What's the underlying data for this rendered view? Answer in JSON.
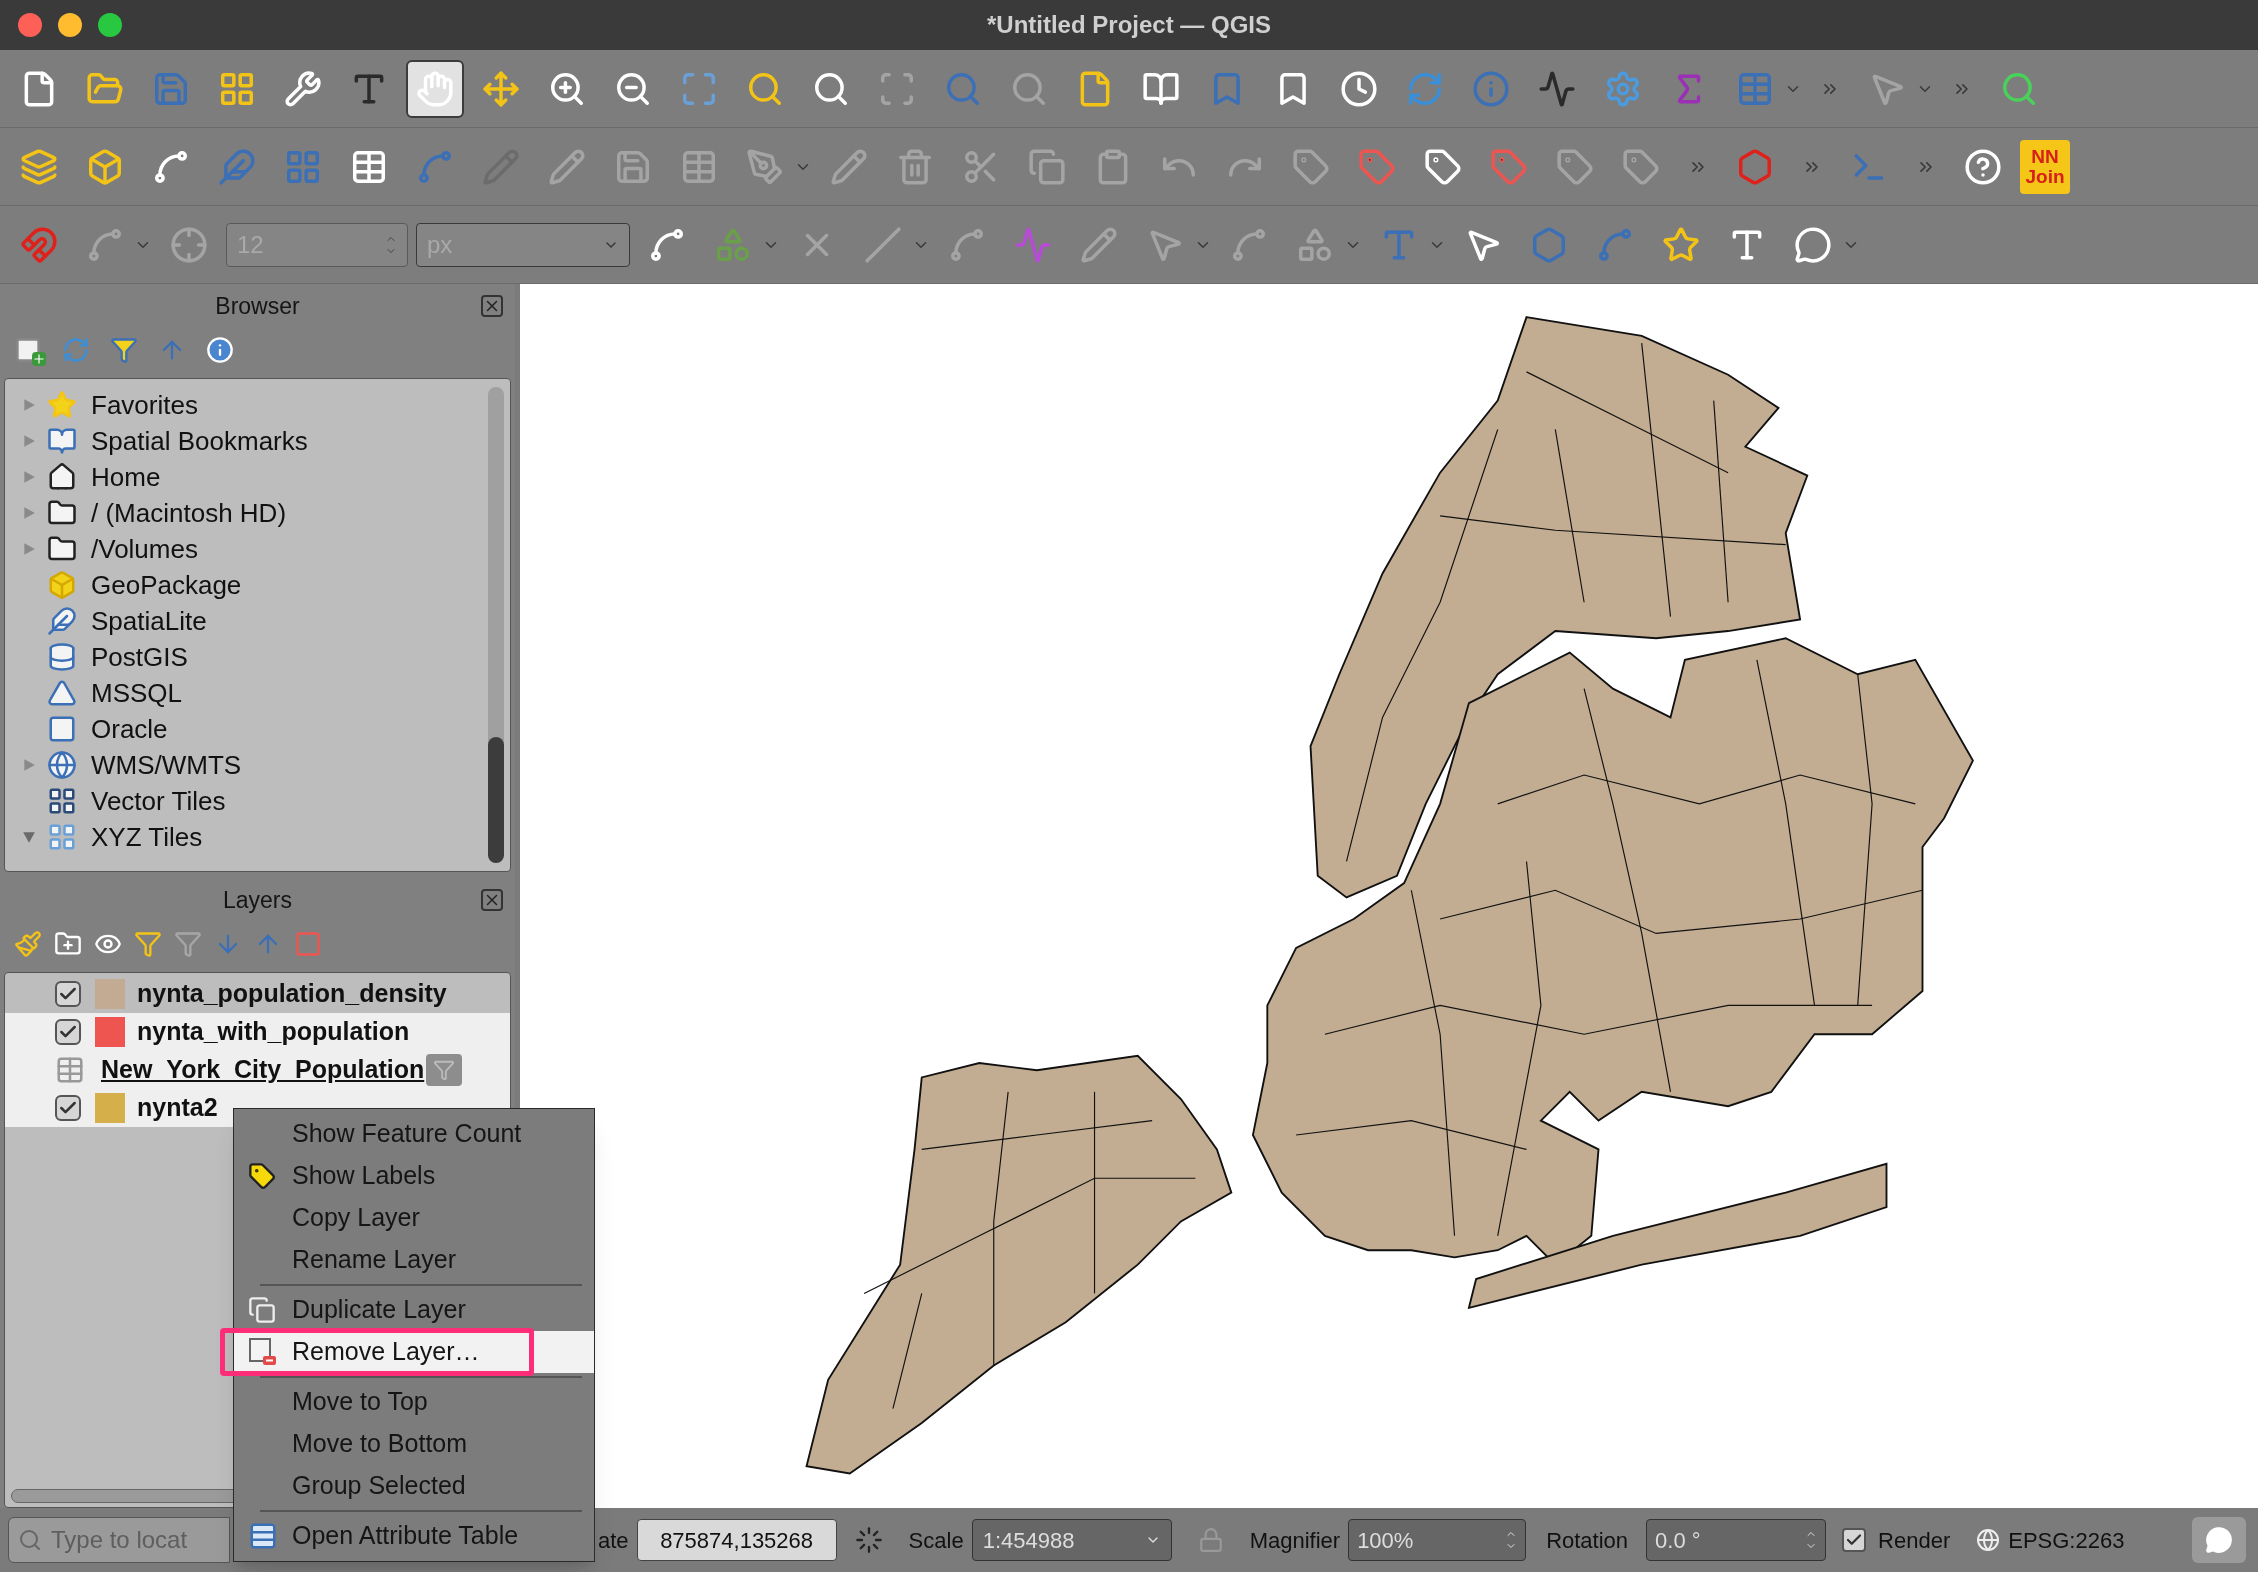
{
  "window": {
    "title": "*Untitled Project — QGIS"
  },
  "toolbars": [
    {
      "items": [
        {
          "kind": "tool",
          "disabled": false,
          "selected": false
        },
        {
          "kind": "tool",
          "disabled": false,
          "selected": false
        },
        {
          "kind": "tool",
          "disabled": false,
          "selected": false
        },
        {
          "kind": "tool",
          "disabled": false,
          "selected": false
        },
        {
          "kind": "tool",
          "disabled": false,
          "selected": false
        },
        {
          "kind": "tool",
          "disabled": false,
          "selected": false
        },
        {
          "kind": "tool",
          "disabled": false,
          "selected": true
        },
        {
          "kind": "tool",
          "disabled": false,
          "selected": false
        },
        {
          "kind": "tool",
          "disabled": false,
          "selected": false
        },
        {
          "kind": "tool",
          "disabled": false,
          "selected": false
        },
        {
          "kind": "tool",
          "disabled": false,
          "selected": false
        },
        {
          "kind": "tool",
          "disabled": false,
          "selected": false
        },
        {
          "kind": "tool",
          "disabled": false,
          "selected": false
        },
        {
          "kind": "tool",
          "disabled": true,
          "selected": false
        },
        {
          "kind": "tool",
          "disabled": false,
          "selected": false
        },
        {
          "kind": "tool",
          "disabled": true,
          "selected": false
        },
        {
          "kind": "tool",
          "disabled": false,
          "selected": false
        },
        {
          "kind": "tool",
          "disabled": false,
          "selected": false
        },
        {
          "kind": "tool",
          "disabled": false,
          "selected": false
        },
        {
          "kind": "tool",
          "disabled": false,
          "selected": false
        },
        {
          "kind": "tool",
          "disabled": false,
          "selected": false
        },
        {
          "kind": "tool",
          "disabled": false,
          "selected": false
        },
        {
          "kind": "tool",
          "disabled": false,
          "selected": false
        },
        {
          "kind": "tool",
          "disabled": false,
          "selected": false
        },
        {
          "kind": "tool",
          "disabled": false,
          "selected": false
        },
        {
          "kind": "tool",
          "disabled": false,
          "selected": false
        },
        {
          "kind": "tool",
          "disabled": false,
          "selected": false
        },
        {
          "kind": "caret"
        },
        {
          "kind": "more"
        },
        {
          "kind": "tool",
          "disabled": true,
          "selected": false
        },
        {
          "kind": "caret"
        },
        {
          "kind": "more"
        },
        {
          "kind": "tool",
          "disabled": false,
          "selected": false
        }
      ]
    },
    {
      "items": [
        {
          "kind": "tool",
          "disabled": false,
          "selected": false
        },
        {
          "kind": "tool",
          "disabled": false,
          "selected": false
        },
        {
          "kind": "tool",
          "disabled": false,
          "selected": false
        },
        {
          "kind": "tool",
          "disabled": false,
          "selected": false
        },
        {
          "kind": "tool",
          "disabled": false,
          "selected": false
        },
        {
          "kind": "tool",
          "disabled": false,
          "selected": false
        },
        {
          "kind": "tool",
          "disabled": false,
          "selected": false
        },
        {
          "kind": "tool",
          "disabled": true,
          "selected": false
        },
        {
          "kind": "tool",
          "disabled": true,
          "selected": false
        },
        {
          "kind": "tool",
          "disabled": true,
          "selected": false
        },
        {
          "kind": "tool",
          "disabled": true,
          "selected": false
        },
        {
          "kind": "tool",
          "disabled": true,
          "selected": false
        },
        {
          "kind": "caret"
        },
        {
          "kind": "tool",
          "disabled": true,
          "selected": false
        },
        {
          "kind": "tool",
          "disabled": true,
          "selected": false
        },
        {
          "kind": "tool",
          "disabled": true,
          "selected": false
        },
        {
          "kind": "tool",
          "disabled": true,
          "selected": false
        },
        {
          "kind": "tool",
          "disabled": true,
          "selected": false
        },
        {
          "kind": "tool",
          "disabled": true,
          "selected": false
        },
        {
          "kind": "tool",
          "disabled": true,
          "selected": false
        },
        {
          "kind": "tool",
          "disabled": true,
          "selected": false
        },
        {
          "kind": "tool",
          "disabled": false,
          "selected": false
        },
        {
          "kind": "tool",
          "disabled": false,
          "selected": false
        },
        {
          "kind": "tool",
          "disabled": false,
          "selected": false
        },
        {
          "kind": "tool",
          "disabled": true,
          "selected": false
        },
        {
          "kind": "tool",
          "disabled": true,
          "selected": false
        },
        {
          "kind": "more"
        },
        {
          "kind": "tool",
          "disabled": false,
          "selected": false
        },
        {
          "kind": "more"
        },
        {
          "kind": "tool",
          "disabled": false,
          "selected": false
        },
        {
          "kind": "more"
        },
        {
          "kind": "tool",
          "disabled": false,
          "selected": false
        },
        {
          "kind": "logo",
          "label": "NN Join"
        }
      ]
    },
    {
      "items": [
        {
          "kind": "tool",
          "disabled": false,
          "selected": false
        },
        {
          "kind": "tool",
          "disabled": true,
          "selected": false
        },
        {
          "kind": "caret"
        },
        {
          "kind": "tool",
          "disabled": true,
          "selected": false
        },
        {
          "kind": "spin",
          "value": "12",
          "disabled": true
        },
        {
          "kind": "select",
          "value": "px",
          "disabled": true
        },
        {
          "kind": "tool",
          "disabled": false,
          "selected": false
        },
        {
          "kind": "tool",
          "disabled": false,
          "selected": false
        },
        {
          "kind": "caret"
        },
        {
          "kind": "tool",
          "disabled": true,
          "selected": false
        },
        {
          "kind": "tool",
          "disabled": true,
          "selected": false
        },
        {
          "kind": "caret"
        },
        {
          "kind": "tool",
          "disabled": true,
          "selected": false
        },
        {
          "kind": "tool",
          "disabled": false,
          "selected": false
        },
        {
          "kind": "tool",
          "disabled": true,
          "selected": false
        },
        {
          "kind": "tool",
          "disabled": true,
          "selected": false
        },
        {
          "kind": "caret"
        },
        {
          "kind": "tool",
          "disabled": true,
          "selected": false
        },
        {
          "kind": "tool",
          "disabled": true,
          "selected": false
        },
        {
          "kind": "caret"
        },
        {
          "kind": "tool",
          "disabled": false,
          "selected": false
        },
        {
          "kind": "caret"
        },
        {
          "kind": "tool",
          "disabled": false,
          "selected": false
        },
        {
          "kind": "tool",
          "disabled": false,
          "selected": false
        },
        {
          "kind": "tool",
          "disabled": false,
          "selected": false
        },
        {
          "kind": "tool",
          "disabled": false,
          "selected": false
        },
        {
          "kind": "tool",
          "disabled": false,
          "selected": false
        },
        {
          "kind": "tool",
          "disabled": false,
          "selected": false
        },
        {
          "kind": "caret"
        }
      ]
    }
  ],
  "browser": {
    "title": "Browser",
    "items": [
      {
        "kind": "branch",
        "label": "Favorites",
        "expanded": false
      },
      {
        "kind": "branch",
        "label": "Spatial Bookmarks",
        "expanded": false
      },
      {
        "kind": "branch",
        "label": "Home",
        "expanded": false
      },
      {
        "kind": "branch",
        "label": "/ (Macintosh HD)",
        "expanded": false
      },
      {
        "kind": "branch",
        "label": "/Volumes",
        "expanded": false
      },
      {
        "kind": "leaf",
        "label": "GeoPackage"
      },
      {
        "kind": "leaf",
        "label": "SpatiaLite"
      },
      {
        "kind": "leaf",
        "label": "PostGIS"
      },
      {
        "kind": "leaf",
        "label": "MSSQL"
      },
      {
        "kind": "leaf",
        "label": "Oracle"
      },
      {
        "kind": "branch",
        "label": "WMS/WMTS",
        "expanded": false
      },
      {
        "kind": "leaf",
        "label": "Vector Tiles"
      },
      {
        "kind": "branch",
        "label": "XYZ Tiles",
        "expanded": true
      }
    ]
  },
  "layers": {
    "title": "Layers",
    "toolbar": [
      {
        "disabled": false
      },
      {
        "disabled": false
      },
      {
        "disabled": false
      },
      {
        "disabled": false
      },
      {
        "disabled": true
      },
      {
        "disabled": false
      },
      {
        "disabled": false
      },
      {
        "disabled": false
      }
    ],
    "items": [
      {
        "kind": "vector",
        "name": "nynta_population_density",
        "checked": true,
        "color": "#c2ab92",
        "selected": false,
        "filtered": false
      },
      {
        "kind": "vector",
        "name": "nynta_with_population",
        "checked": true,
        "color": "#ee5550",
        "selected": true,
        "filtered": false
      },
      {
        "kind": "table",
        "name": "New_York_City_Population",
        "selected": true,
        "filtered": true
      },
      {
        "kind": "vector",
        "name": "nynta2",
        "checked": true,
        "color": "#d4af4a",
        "selected": true,
        "filtered": false
      }
    ]
  },
  "context_menu": {
    "items": [
      {
        "kind": "item",
        "label": "Show Feature Count",
        "selected": false
      },
      {
        "kind": "item",
        "label": "Show Labels",
        "selected": false
      },
      {
        "kind": "item",
        "label": "Copy Layer",
        "selected": false
      },
      {
        "kind": "item",
        "label": "Rename Layer",
        "selected": false
      },
      {
        "kind": "separator"
      },
      {
        "kind": "item",
        "label": "Duplicate Layer",
        "selected": false
      },
      {
        "kind": "item",
        "label": "Remove Layer…",
        "selected": true
      },
      {
        "kind": "separator"
      },
      {
        "kind": "item",
        "label": "Move to Top",
        "selected": false
      },
      {
        "kind": "item",
        "label": "Move to Bottom",
        "selected": false
      },
      {
        "kind": "item",
        "label": "Group Selected",
        "selected": false
      },
      {
        "kind": "separator"
      },
      {
        "kind": "item",
        "label": "Open Attribute Table",
        "selected": false
      }
    ]
  },
  "status_bar": {
    "locator": {
      "placeholder": "Type to locat"
    },
    "coordinate_label": "ate",
    "coordinate": "875874,135268",
    "scale_label": "Scale",
    "scale": "1:454988",
    "magnifier_label": "Magnifier",
    "magnifier": "100%",
    "rotation_label": "Rotation",
    "rotation": "0.0 °",
    "render": {
      "label": "Render",
      "checked": true
    },
    "crs": "EPSG:2263"
  }
}
